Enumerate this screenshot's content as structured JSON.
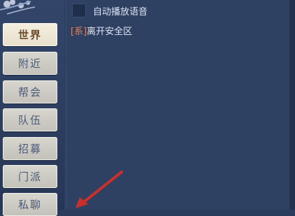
{
  "sidebar": {
    "tabs": [
      {
        "label": "世界",
        "active": true
      },
      {
        "label": "附近",
        "active": false
      },
      {
        "label": "帮会",
        "active": false
      },
      {
        "label": "队伍",
        "active": false
      },
      {
        "label": "招募",
        "active": false
      },
      {
        "label": "门派",
        "active": false
      },
      {
        "label": "私聊",
        "active": false
      }
    ]
  },
  "main": {
    "autoplay_label": "自动播放语音",
    "messages": [
      {
        "tag": "[系]",
        "text": "离开安全区"
      }
    ]
  },
  "colors": {
    "panel": "#2f4163",
    "tab_active_text": "#6a4a28",
    "tab_text": "#4b5a78",
    "system_tag": "#e0805a",
    "arrow": "#c9302c"
  }
}
